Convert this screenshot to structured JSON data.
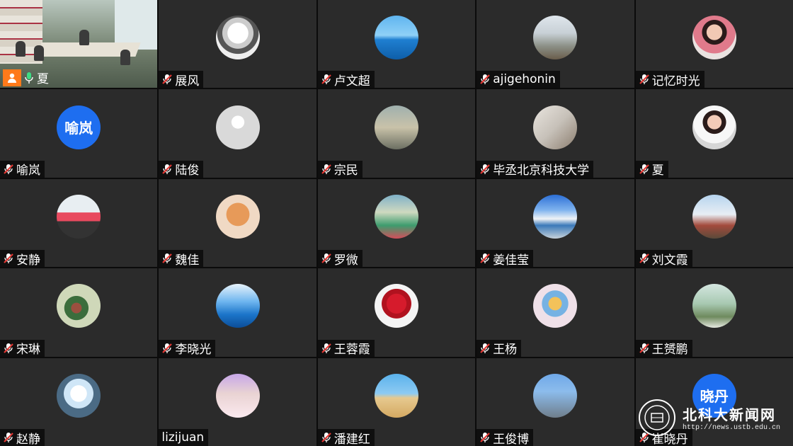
{
  "host": {
    "name": "夏"
  },
  "participants": [
    {
      "name": "展风",
      "avatar": "sketch"
    },
    {
      "name": "卢文超",
      "avatar": "sea"
    },
    {
      "name": "ajigehonin",
      "avatar": "winter"
    },
    {
      "name": "记忆时光",
      "avatar": "portrait"
    },
    {
      "name": "喻岚",
      "avatar_text": "喻岚"
    },
    {
      "name": "陆俊",
      "avatar": "default"
    },
    {
      "name": "宗民",
      "avatar": "horse"
    },
    {
      "name": "毕丞北京科技大学",
      "avatar": "tea"
    },
    {
      "name": "夏",
      "avatar": "portrait2"
    },
    {
      "name": "安静",
      "avatar": "person"
    },
    {
      "name": "魏佳",
      "avatar": "cat"
    },
    {
      "name": "罗微",
      "avatar": "kid"
    },
    {
      "name": "姜佳莹",
      "avatar": "sky"
    },
    {
      "name": "刘文霞",
      "avatar": "mountain"
    },
    {
      "name": "宋琳",
      "avatar": "bird"
    },
    {
      "name": "李晓光",
      "avatar": "ocean"
    },
    {
      "name": "王蓉霞",
      "avatar": "roses"
    },
    {
      "name": "王杨",
      "avatar": "bear"
    },
    {
      "name": "王赟鹏",
      "avatar": "plant"
    },
    {
      "name": "赵静",
      "avatar": "snow"
    },
    {
      "name": "lizijuan",
      "avatar": "woman",
      "unmuted": true
    },
    {
      "name": "潘建红",
      "avatar": "desert"
    },
    {
      "name": "王俊博",
      "avatar": "tree"
    },
    {
      "name": "崔晓丹",
      "avatar_text": "晓丹"
    }
  ],
  "watermark": {
    "title": "北科大新闻网",
    "url": "http://news.ustb.edu.cn"
  },
  "colors": {
    "accent_green": "#4caf50",
    "avatar_blue": "#1e6ef0",
    "host_orange": "#ff7a1a",
    "mute_red": "#e53935"
  }
}
